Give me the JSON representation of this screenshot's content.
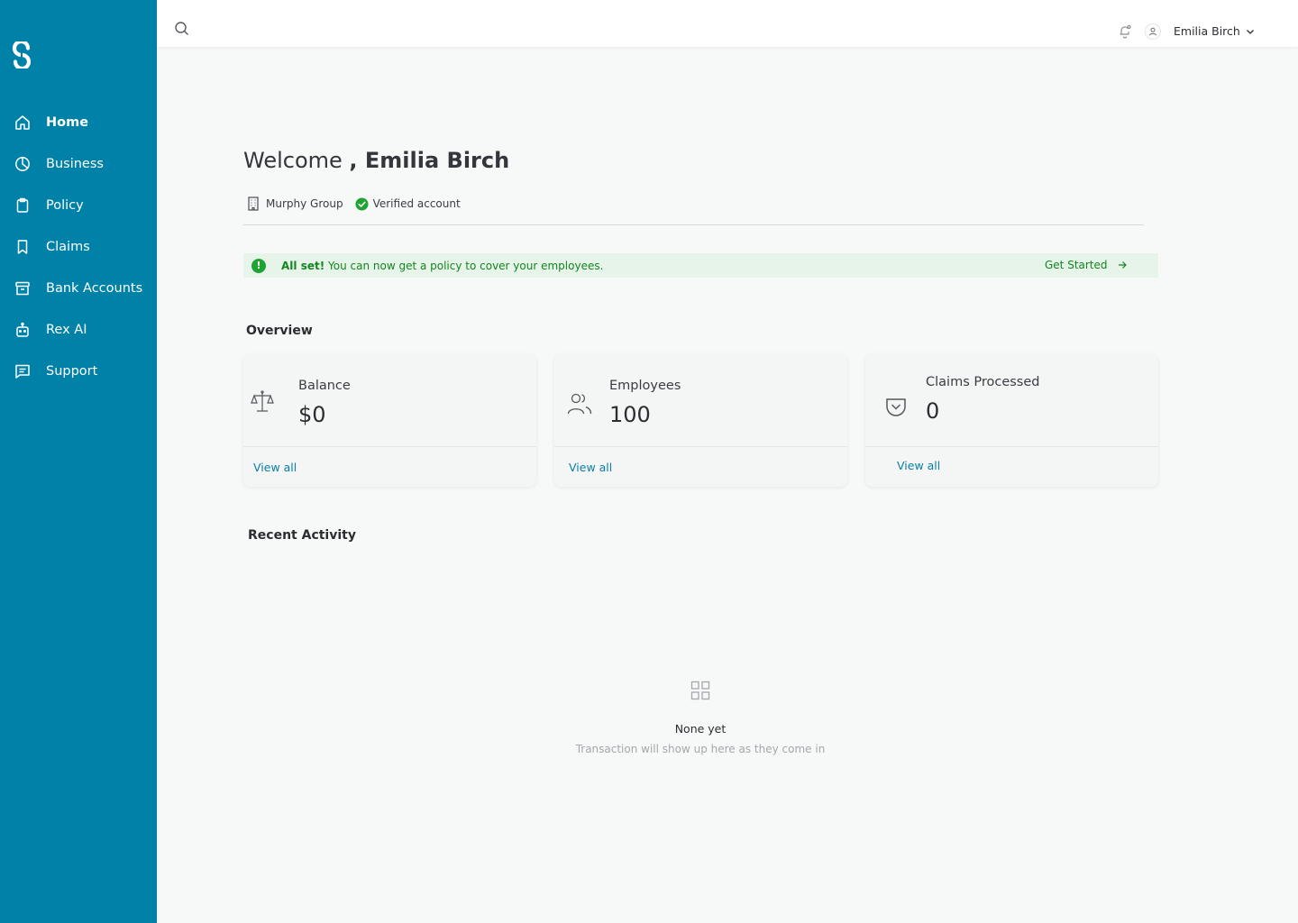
{
  "colors": {
    "sidebar_bg": "#0081a7",
    "page_bg": "#f7f8f8",
    "success": "#21a333",
    "success_text": "#13851f",
    "success_bg": "#e6f4ea",
    "link": "#0a7ea8"
  },
  "sidebar": {
    "logo_icon": "s-logo-icon",
    "items": [
      {
        "label": "Home",
        "icon": "home-icon",
        "active": true
      },
      {
        "label": "Business",
        "icon": "pie-chart-icon",
        "active": false
      },
      {
        "label": "Policy",
        "icon": "clipboard-icon",
        "active": false
      },
      {
        "label": "Claims",
        "icon": "bookmark-icon",
        "active": false
      },
      {
        "label": "Bank Accounts",
        "icon": "archive-icon",
        "active": false
      },
      {
        "label": "Rex AI",
        "icon": "robot-icon",
        "active": false
      },
      {
        "label": "Support",
        "icon": "message-icon",
        "active": false
      }
    ]
  },
  "topbar": {
    "user_name": "Emilia Birch"
  },
  "welcome": {
    "greeting": "Welcome ",
    "name": ", Emilia Birch",
    "company": "Murphy Group",
    "verified": "Verified account"
  },
  "banner": {
    "strong": "All set!",
    "message": " You can now get a policy to cover your employees.",
    "cta": "Get Started"
  },
  "overview": {
    "title": "Overview",
    "cards": [
      {
        "label": "Balance",
        "value": "$0",
        "link": "View all",
        "icon": "scale-icon"
      },
      {
        "label": "Employees",
        "value": "100",
        "link": "View all",
        "icon": "users-icon"
      },
      {
        "label": "Claims Processed",
        "value": "0",
        "link": "View all",
        "icon": "pocket-icon"
      }
    ]
  },
  "recent_activity": {
    "title": "Recent Activity",
    "empty_title": "None yet",
    "empty_subtitle": "Transaction will show up here as they come in"
  }
}
